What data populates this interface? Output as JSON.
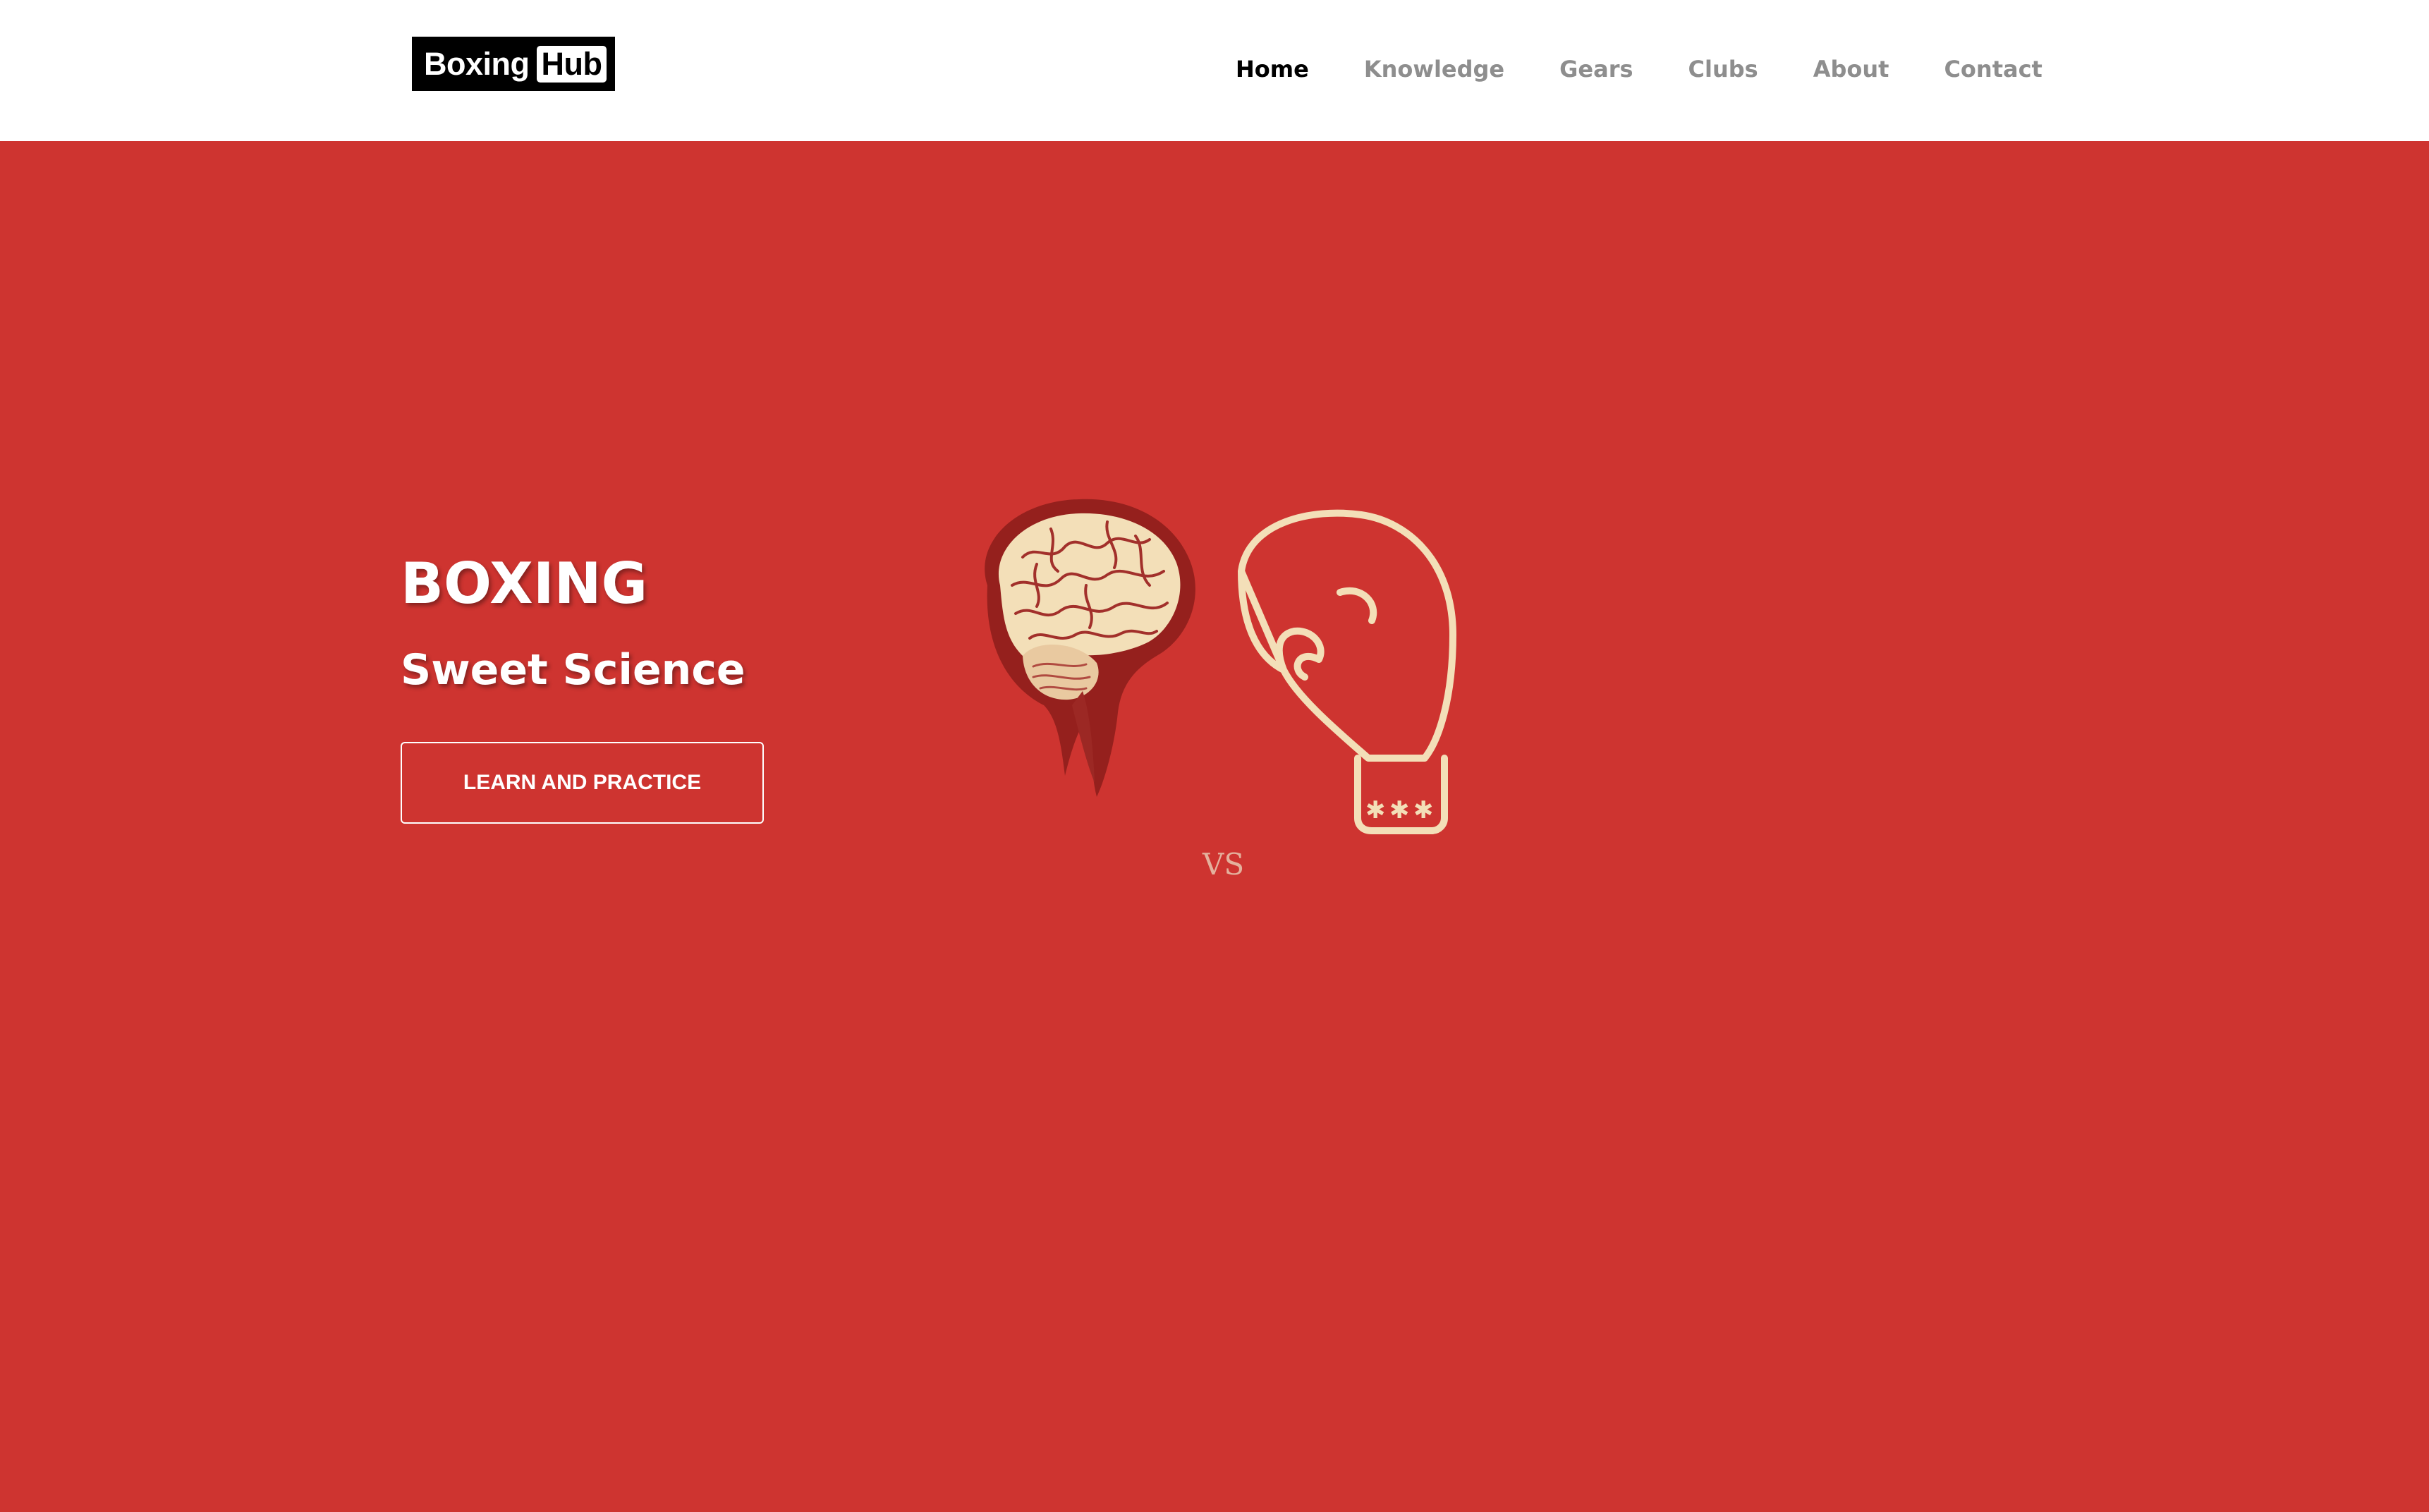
{
  "brand": {
    "word": "Boxing",
    "box": "Hub"
  },
  "nav": {
    "items": [
      {
        "label": "Home",
        "active": true
      },
      {
        "label": "Knowledge",
        "active": false
      },
      {
        "label": "Gears",
        "active": false
      },
      {
        "label": "Clubs",
        "active": false
      },
      {
        "label": "About",
        "active": false
      },
      {
        "label": "Contact",
        "active": false
      }
    ]
  },
  "hero": {
    "title": "BOXING",
    "subtitle": "Sweet Science",
    "cta_label": "LEARN AND PRACTICE",
    "illustration": {
      "left_icon": "brain-icon",
      "versus_text": "VS",
      "right_icon": "boxing-glove-icon"
    }
  },
  "colors": {
    "hero_background": "#ce3430",
    "navbar_background": "#ffffff",
    "nav_active": "#000000",
    "nav_inactive": "#8e8e8e",
    "illustration_cream": "#f3dfb8",
    "illustration_dark": "#8b1d1a"
  }
}
